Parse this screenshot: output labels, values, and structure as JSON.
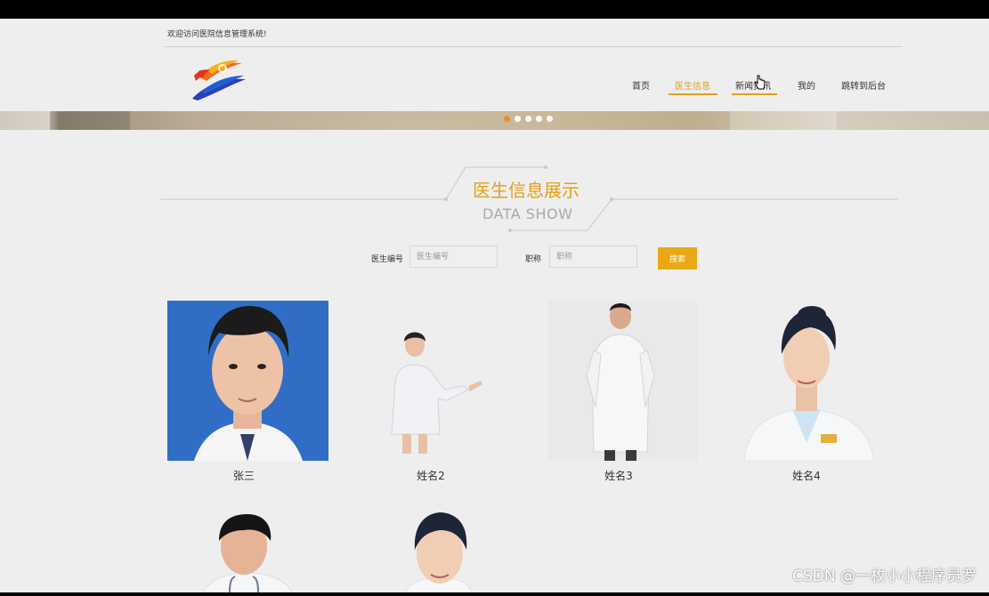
{
  "header": {
    "welcome_text": "欢迎访问医院信息管理系统!",
    "nav": [
      {
        "label": "首页"
      },
      {
        "label": "医生信息"
      },
      {
        "label": "新闻资讯"
      },
      {
        "label": "我的"
      },
      {
        "label": "跳转到后台"
      }
    ],
    "active_nav_index": 1,
    "accent_color": "#e0a21a"
  },
  "banner": {
    "dot_count": 5,
    "active_dot_index": 0
  },
  "section": {
    "title_cn": "医生信息展示",
    "title_en": "DATA SHOW"
  },
  "search": {
    "field1_label": "医生编号",
    "field1_placeholder": "医生编号",
    "field2_label": "职称",
    "field2_placeholder": "职称",
    "button_label": "搜索",
    "button_color": "#e9a814"
  },
  "doctors": [
    {
      "name": "张三"
    },
    {
      "name": "姓名2"
    },
    {
      "name": "姓名3"
    },
    {
      "name": "姓名4"
    },
    {
      "name": ""
    },
    {
      "name": ""
    }
  ],
  "watermark": "CSDN @一枚小小程序员罗"
}
